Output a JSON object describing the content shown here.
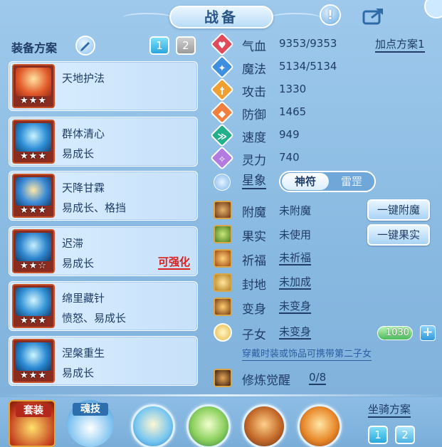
{
  "header": {
    "title": "战备",
    "alert_glyph": "!"
  },
  "left": {
    "plan_label": "装备方案",
    "plan_buttons": [
      {
        "label": "1",
        "active": true
      },
      {
        "label": "2",
        "active": false
      }
    ],
    "skills": [
      {
        "name": "天地护法",
        "desc": "",
        "stars": "★★★",
        "upgrade": "",
        "icon": "shield-ward-icon"
      },
      {
        "name": "群体清心",
        "desc": "易成长",
        "stars": "★★★",
        "upgrade": "",
        "icon": "cleanse-icon"
      },
      {
        "name": "天降甘霖",
        "desc": "易成长、格挡",
        "stars": "★★★",
        "upgrade": "",
        "icon": "rain-icon"
      },
      {
        "name": "迟滞",
        "desc": "易成长",
        "stars": "★★☆",
        "upgrade": "可强化",
        "icon": "slow-icon"
      },
      {
        "name": "绵里藏针",
        "desc": "愤怒、易成长",
        "stars": "★★★",
        "upgrade": "",
        "icon": "needle-icon"
      },
      {
        "name": "涅槃重生",
        "desc": "易成长",
        "stars": "★★★",
        "upgrade": "",
        "icon": "rebirth-icon"
      }
    ]
  },
  "stats": {
    "add_plan": "加点方案1",
    "items": [
      {
        "label": "气血",
        "value": "9353/9353",
        "color": "#e04a5a",
        "glyph": "♥"
      },
      {
        "label": "魔法",
        "value": "5134/5134",
        "color": "#3f8fe0",
        "glyph": "✦"
      },
      {
        "label": "攻击",
        "value": "1330",
        "color": "#f0a030",
        "glyph": "†"
      },
      {
        "label": "防御",
        "value": "1465",
        "color": "#f08040",
        "glyph": "◆"
      },
      {
        "label": "速度",
        "value": "949",
        "color": "#22b08a",
        "glyph": "≫"
      },
      {
        "label": "灵力",
        "value": "740",
        "color": "#b27be0",
        "glyph": "✧"
      }
    ],
    "star_label": "星象",
    "toggle": {
      "on": "神符",
      "off": "雷罡"
    }
  },
  "extras": [
    {
      "label": "附魔",
      "value": "未附魔",
      "underline": false,
      "button": "一键附魔"
    },
    {
      "label": "果实",
      "value": "未使用",
      "underline": false,
      "button": "一键果实"
    },
    {
      "label": "祈福",
      "value": "未祈福",
      "underline": true,
      "button": ""
    },
    {
      "label": "封地",
      "value": "未加成",
      "underline": true,
      "button": ""
    },
    {
      "label": "变身",
      "value": "未变身",
      "underline": true,
      "button": ""
    }
  ],
  "child": {
    "label": "子女",
    "value": "未变身",
    "bar_value": "1030",
    "plus": "+",
    "fill": 0.35
  },
  "hint": "穿戴时装或饰品可携带第二子女",
  "cultivation": {
    "label": "修炼觉醒",
    "value": "0/8"
  },
  "bottom": {
    "tabs": [
      {
        "label": "套装"
      },
      {
        "label": "魂技"
      }
    ],
    "mount_label": "坐骑方案",
    "mount_buttons": [
      {
        "label": "1"
      },
      {
        "label": "2"
      }
    ]
  }
}
